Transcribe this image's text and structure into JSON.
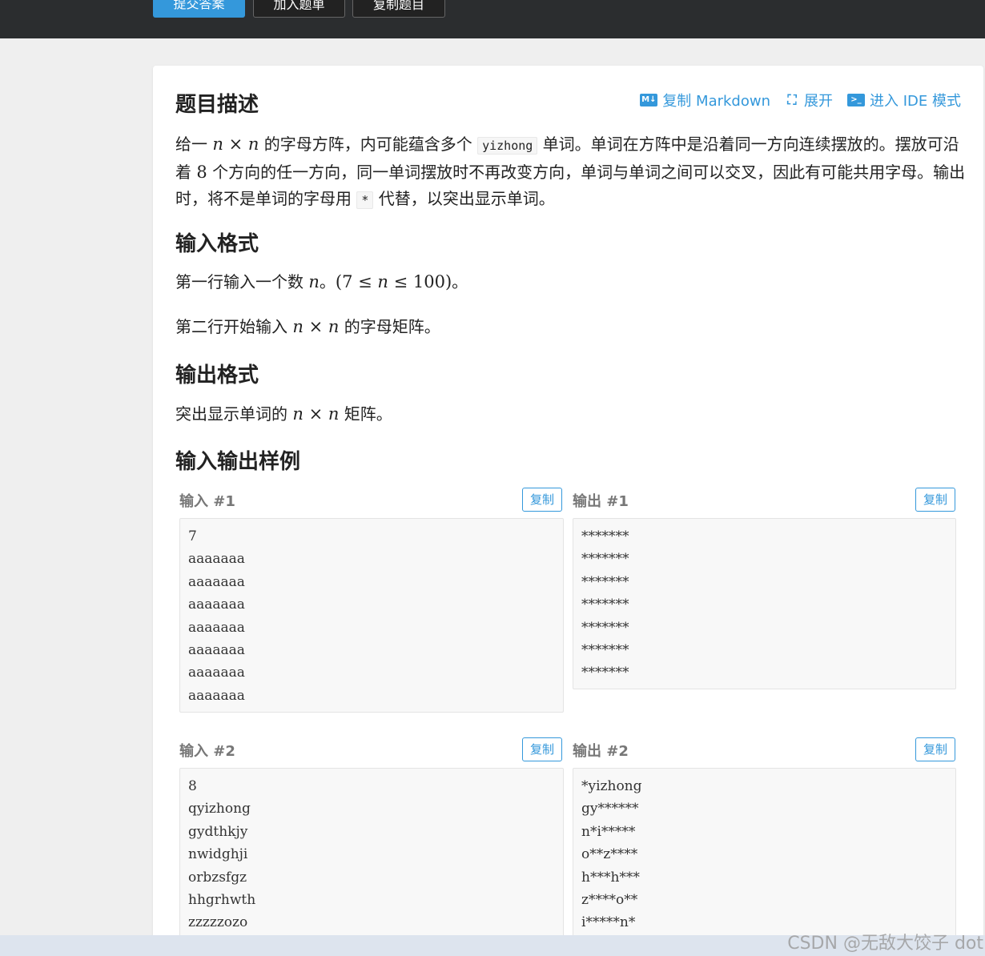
{
  "toolbar": {
    "submit": "提交答案",
    "add_list": "加入题单",
    "copy_problem": "复制题目"
  },
  "tools": {
    "copy_markdown": "复制 Markdown",
    "expand": "展开",
    "ide": "进入 IDE 模式",
    "md_icon": "M↓",
    "ide_icon": ">_"
  },
  "sections": {
    "description_title": "题目描述",
    "input_title": "输入格式",
    "output_title": "输出格式",
    "samples_title": "输入输出样例"
  },
  "description": {
    "p1": "给一 ",
    "n1": "n",
    "times1": " × ",
    "n2": "n",
    "p2": " 的字母方阵，内可能蕴含多个 ",
    "word": "yizhong",
    "p3": " 单词。单词在方阵中是沿着同一方向连续摆放的。摆放可沿着 ",
    "eight": "8",
    "p4": " 个方向的任一方向，同一单词摆放时不再改变方向，单词与单词之间可以交叉，因此有可能共用字母。输出时，将不是单词的字母用 ",
    "star": "*",
    "p5": " 代替，以突出显示单词。"
  },
  "input_format": {
    "line1_a": "第一行输入一个数 ",
    "line1_n": "n",
    "line1_b": "。",
    "line1_math": "(7 ≤ ",
    "line1_n2": "n",
    "line1_math2": " ≤ 100)",
    "line1_c": "。",
    "line2_a": "第二行开始输入 ",
    "line2_n1": "n",
    "line2_x": " × ",
    "line2_n2": "n",
    "line2_b": " 的字母矩阵。"
  },
  "output_format": {
    "a": "突出显示单词的 ",
    "n1": "n",
    "x": " × ",
    "n2": "n",
    "b": " 矩阵。"
  },
  "samples": [
    {
      "input_label": "输入 #1",
      "output_label": "输出 #1",
      "copy": "复制",
      "input": "7\naaaaaaa\naaaaaaa\naaaaaaa\naaaaaaa\naaaaaaa\naaaaaaa\naaaaaaa",
      "output": "*******\n*******\n*******\n*******\n*******\n*******\n*******"
    },
    {
      "input_label": "输入 #2",
      "output_label": "输出 #2",
      "copy": "复制",
      "input": "8\nqyizhong\ngydthkjy\nnwidghji\norbzsfgz\nhhgrhwth\nzzzzzozo",
      "output": "*yizhong\ngy******\nn*i*****\no**z****\nh***h***\nz****o**\ni*****n*"
    }
  ],
  "watermark": "CSDN @无敌大饺子 dot"
}
